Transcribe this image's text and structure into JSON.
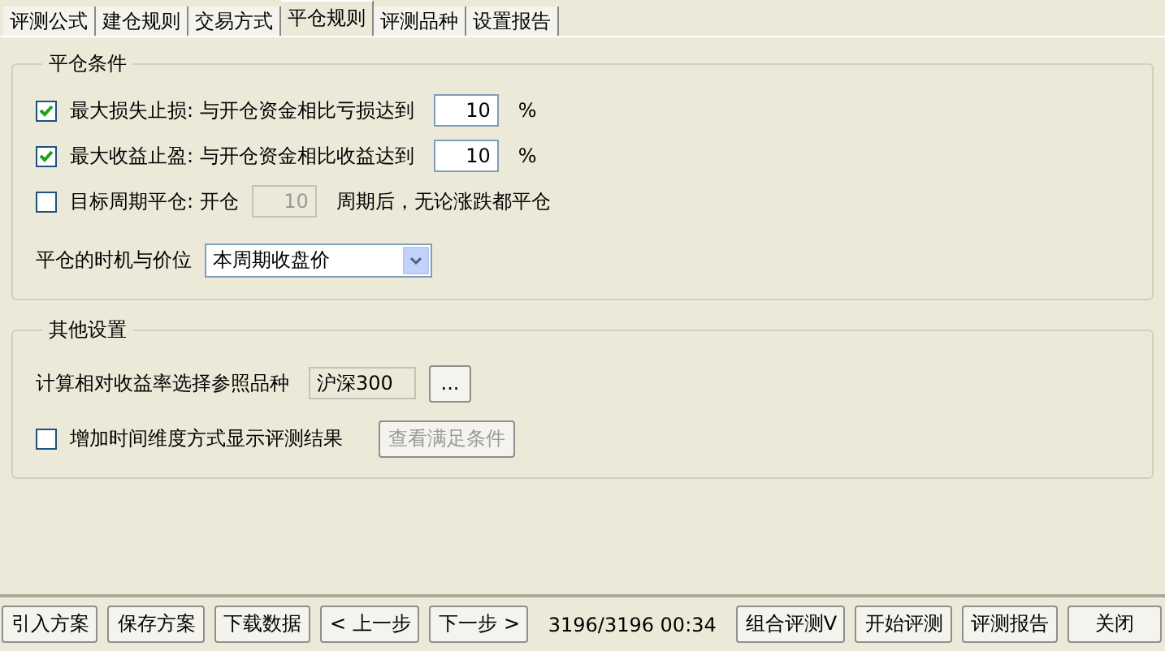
{
  "tabs": [
    {
      "label": "评测公式",
      "selected": false
    },
    {
      "label": "建仓规则",
      "selected": false
    },
    {
      "label": "交易方式",
      "selected": false
    },
    {
      "label": "平仓规则",
      "selected": true
    },
    {
      "label": "评测品种",
      "selected": false
    },
    {
      "label": "设置报告",
      "selected": false
    }
  ],
  "exit_conditions": {
    "title": "平仓条件",
    "rows": [
      {
        "checked": true,
        "label": "最大损失止损: 与开仓资金相比亏损达到",
        "value": "10",
        "suffix": "%",
        "input_disabled": false
      },
      {
        "checked": true,
        "label": "最大收益止盈: 与开仓资金相比收益达到",
        "value": "10",
        "suffix": "%",
        "input_disabled": false
      },
      {
        "checked": false,
        "label": "目标周期平仓: 开仓",
        "value": "10",
        "suffix": "周期后，无论涨跌都平仓",
        "input_disabled": true
      }
    ],
    "timing": {
      "label": "平仓的时机与价位",
      "value": "本周期收盘价"
    }
  },
  "other_settings": {
    "title": "其他设置",
    "reference": {
      "label": "计算相对收益率选择参照品种",
      "value": "沪深300",
      "button": "..."
    },
    "time_dimension": {
      "checked": false,
      "label": "增加时间维度方式显示评测结果",
      "button": "查看满足条件",
      "button_disabled": true
    }
  },
  "footer": {
    "left_buttons": [
      "引入方案",
      "保存方案",
      "下载数据",
      "< 上一步",
      "下一步 >"
    ],
    "status": "3196/3196 00:34",
    "right_buttons": [
      "组合评测V",
      "开始评测",
      "评测报告",
      "关闭"
    ]
  }
}
